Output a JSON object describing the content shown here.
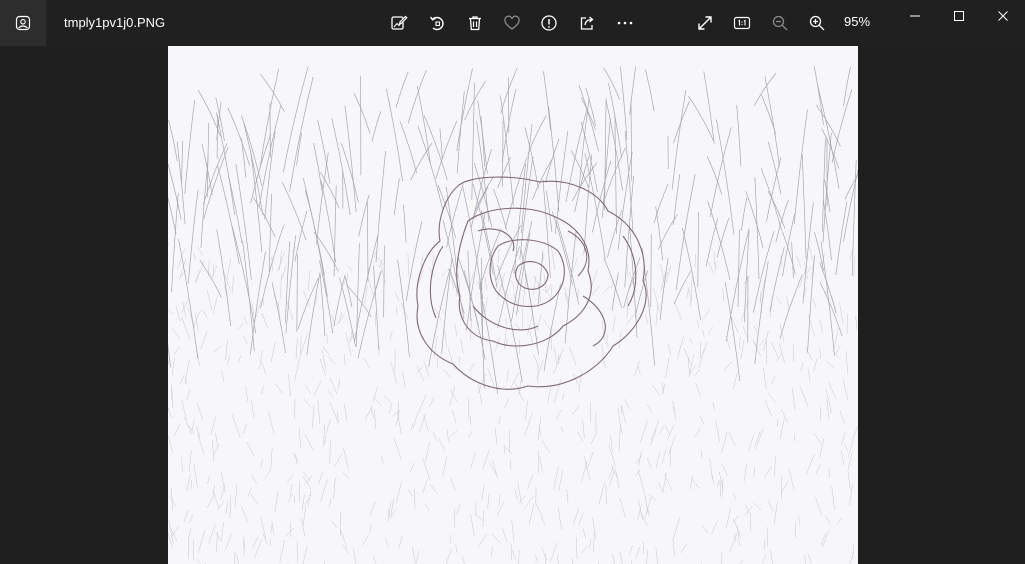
{
  "window": {
    "file_name": "tmply1pv1j0.PNG",
    "zoom_level": "95%"
  },
  "toolbar": {
    "items": [
      {
        "id": "edit",
        "icon": "edit-image-icon"
      },
      {
        "id": "rotate",
        "icon": "rotate-icon"
      },
      {
        "id": "delete",
        "icon": "trash-icon"
      },
      {
        "id": "favorite",
        "icon": "heart-icon"
      },
      {
        "id": "info",
        "icon": "info-icon"
      },
      {
        "id": "share",
        "icon": "share-icon"
      },
      {
        "id": "more",
        "icon": "more-icon"
      },
      {
        "id": "fullscreen",
        "icon": "expand-icon"
      },
      {
        "id": "actual-size",
        "icon": "actual-size-icon"
      },
      {
        "id": "zoom-out",
        "icon": "zoom-out-icon"
      },
      {
        "id": "zoom-in",
        "icon": "zoom-in-icon"
      }
    ]
  },
  "window_controls": [
    "minimize-icon",
    "maximize-icon",
    "close-icon"
  ],
  "image": {
    "subject": "pencil-sketch rose among grass",
    "colors": {
      "paper": "#f7f7f9",
      "line": "#6e6a78",
      "rose_line": "#8a6a72"
    }
  },
  "colors": {
    "background": "#202020",
    "icon": "#ffffff",
    "disabled_icon": "#8a8a8a"
  }
}
